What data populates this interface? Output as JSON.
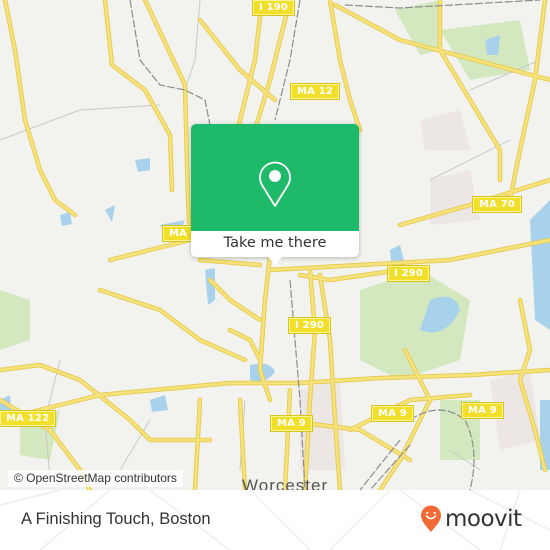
{
  "map": {
    "colors": {
      "land": "#f2f2ee",
      "road": "#f6e27a",
      "road_casing": "#e5c94c",
      "water": "#a8d2ec",
      "park": "#d4e8c0",
      "urban": "#ece6e4",
      "rail": "#8c8c8c",
      "minor_road": "#c8c8c8"
    },
    "shields": [
      {
        "id": "i190",
        "label": "I 190"
      },
      {
        "id": "ma12",
        "label": "MA 12"
      },
      {
        "id": "ma70",
        "label": "MA 70"
      },
      {
        "id": "ma-left",
        "label": "MA"
      },
      {
        "id": "i290-east",
        "label": "I 290"
      },
      {
        "id": "i290-south",
        "label": "I 290"
      },
      {
        "id": "ma122",
        "label": "MA 122"
      },
      {
        "id": "ma9-center",
        "label": "MA 9"
      },
      {
        "id": "ma9-east",
        "label": "MA 9"
      },
      {
        "id": "ma9-far-east",
        "label": "MA 9"
      }
    ],
    "city_label": "Worcester",
    "attribution": "© OpenStreetMap contributors"
  },
  "popup": {
    "icon": "location-pin-icon",
    "button_label": "Take me there",
    "color": "#1fb96a"
  },
  "footer": {
    "place_title": "A Finishing Touch, Boston",
    "logo_text": "moovit",
    "logo_color": "#f26a36"
  }
}
